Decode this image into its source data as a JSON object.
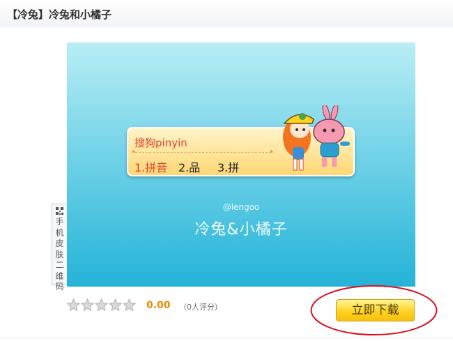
{
  "header": {
    "title": "【冷兔】冷兔和小橘子"
  },
  "preview": {
    "ime": {
      "pinyin": "搜狗pinyin",
      "candidates": [
        "1.拼音",
        "2.品",
        "3.拼"
      ]
    },
    "handle": "@lengoo",
    "skin_name": "冷兔&小橘子"
  },
  "qr_tab": {
    "label": "手机皮肤二维码",
    "icon": "qr-code-icon"
  },
  "rating": {
    "stars": [
      0,
      0,
      0,
      0,
      0
    ],
    "score": "0.00",
    "count_text": "（0人评分）",
    "star_icon": "star-icon"
  },
  "download": {
    "label": "立即下载"
  },
  "colors": {
    "accent_orange": "#ee8a00",
    "button_yellow": "#ffd323",
    "annotation_red": "#d6101a",
    "preview_blue": "#24b3d8"
  }
}
